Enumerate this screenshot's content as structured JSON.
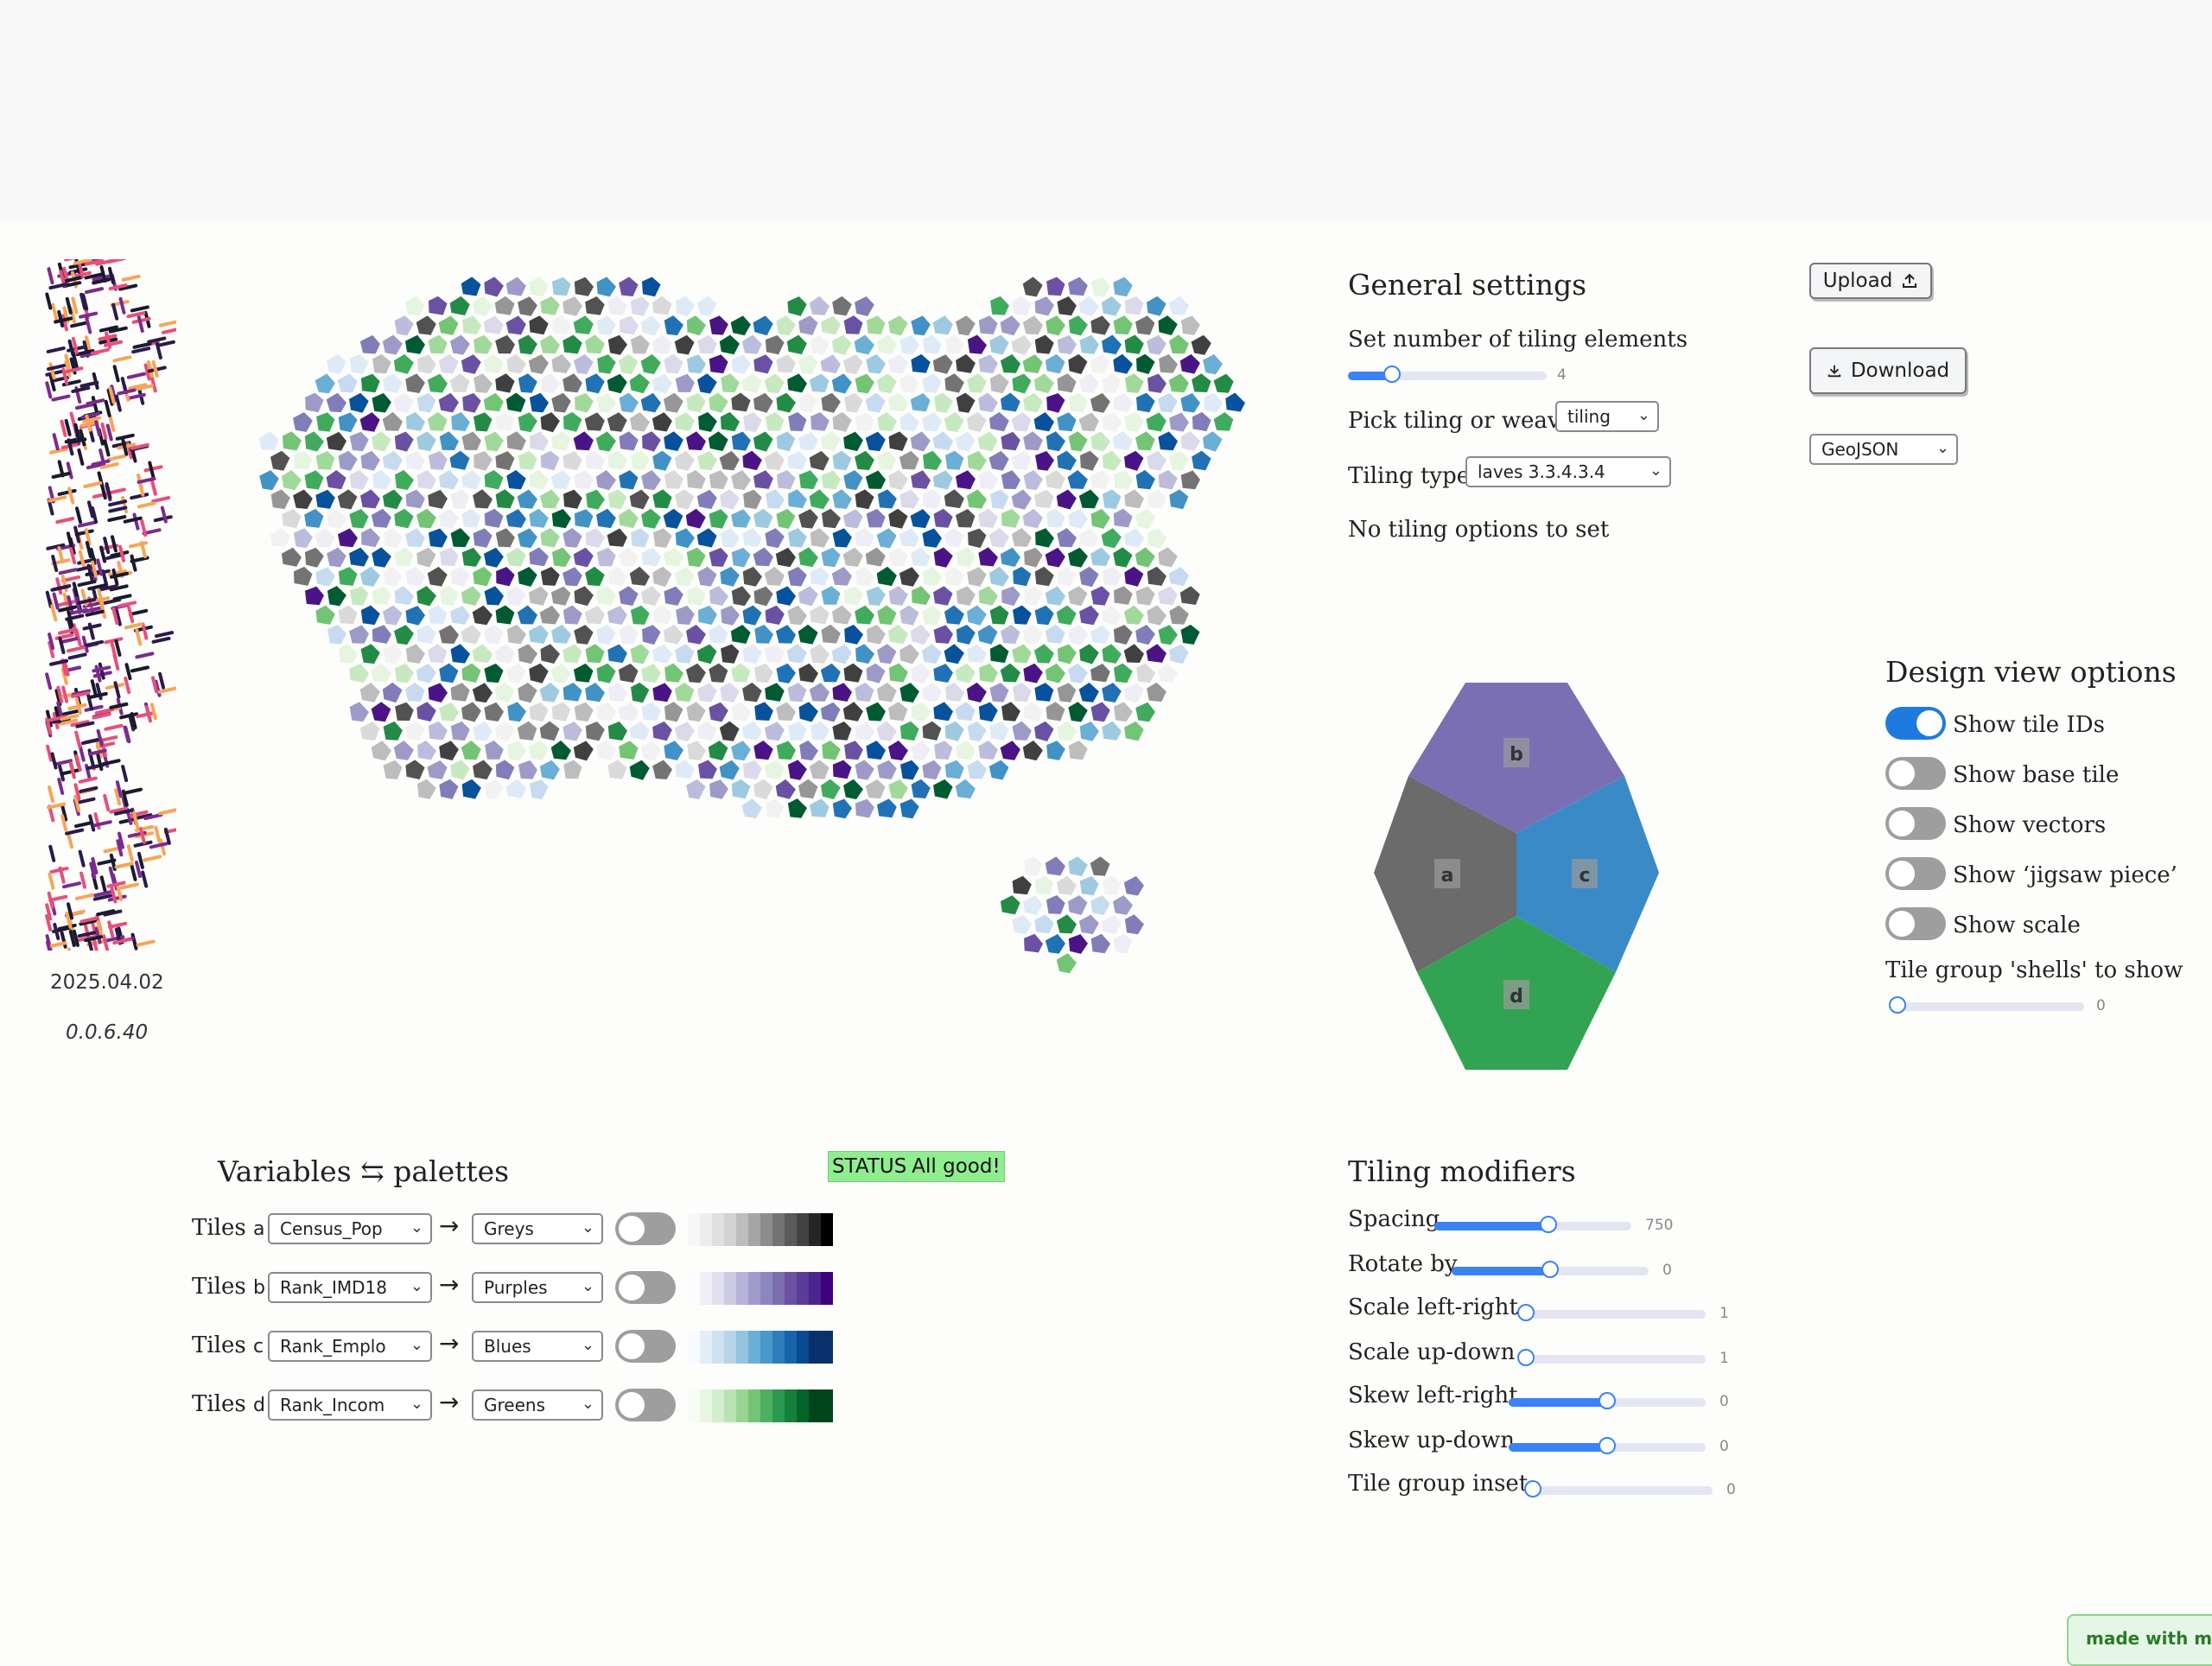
{
  "app": {
    "date": "2025.04.02",
    "version": "0.0.6.40"
  },
  "general": {
    "title": "General settings",
    "num_label": "Set number of tiling elements",
    "num_value": "4",
    "num_fraction": 0.22,
    "pick_label": "Pick tiling or weave",
    "pick_value": "tiling",
    "type_label": "Tiling type",
    "type_value": "laves 3.3.4.3.4",
    "no_options": "No tiling options to set"
  },
  "io": {
    "upload": "Upload",
    "download": "Download",
    "format": "GeoJSON"
  },
  "tile_preview": {
    "labels": [
      "b",
      "a",
      "c",
      "d"
    ],
    "colors": {
      "a": "#6b6b6b",
      "b": "#7b6fb3",
      "c": "#3a8ac6",
      "d": "#32a352"
    }
  },
  "design": {
    "title": "Design view options",
    "toggles": [
      {
        "label": "Show tile IDs",
        "on": true
      },
      {
        "label": "Show base tile",
        "on": false
      },
      {
        "label": "Show vectors",
        "on": false
      },
      {
        "label": "Show ‘jigsaw piece’",
        "on": false
      },
      {
        "label": "Show scale",
        "on": false
      }
    ],
    "shells_label": "Tile group 'shells' to show",
    "shells_value": "0"
  },
  "variables": {
    "title": "Variables ⇆ palettes",
    "status_label": "STATUS",
    "status_text": "All good!",
    "rows": [
      {
        "prefix": "Tiles",
        "tag": "a",
        "variable": "Census_Pop",
        "palette": "Greys",
        "arrow": "→"
      },
      {
        "prefix": "Tiles",
        "tag": "b",
        "variable": "Rank_IMD18",
        "palette": "Purples",
        "arrow": "→"
      },
      {
        "prefix": "Tiles",
        "tag": "c",
        "variable": "Rank_Emplo",
        "palette": "Blues",
        "arrow": "→"
      },
      {
        "prefix": "Tiles",
        "tag": "d",
        "variable": "Rank_Incom",
        "palette": "Greens",
        "arrow": "→"
      }
    ]
  },
  "modifiers": {
    "title": "Tiling modifiers",
    "items": [
      {
        "label": "Spacing",
        "value": "750",
        "fraction": 0.58
      },
      {
        "label": "Rotate by",
        "value": "0",
        "fraction": 0.5
      },
      {
        "label": "Scale left-right",
        "value": "1",
        "fraction": 0.0
      },
      {
        "label": "Scale up-down",
        "value": "1",
        "fraction": 0.0
      },
      {
        "label": "Skew left-right",
        "value": "0",
        "fraction": 0.5
      },
      {
        "label": "Skew up-down",
        "value": "0",
        "fraction": 0.5
      },
      {
        "label": "Tile group inset",
        "value": "0",
        "fraction": 0.0
      }
    ]
  },
  "footer": {
    "made_with": "made with marimo"
  }
}
